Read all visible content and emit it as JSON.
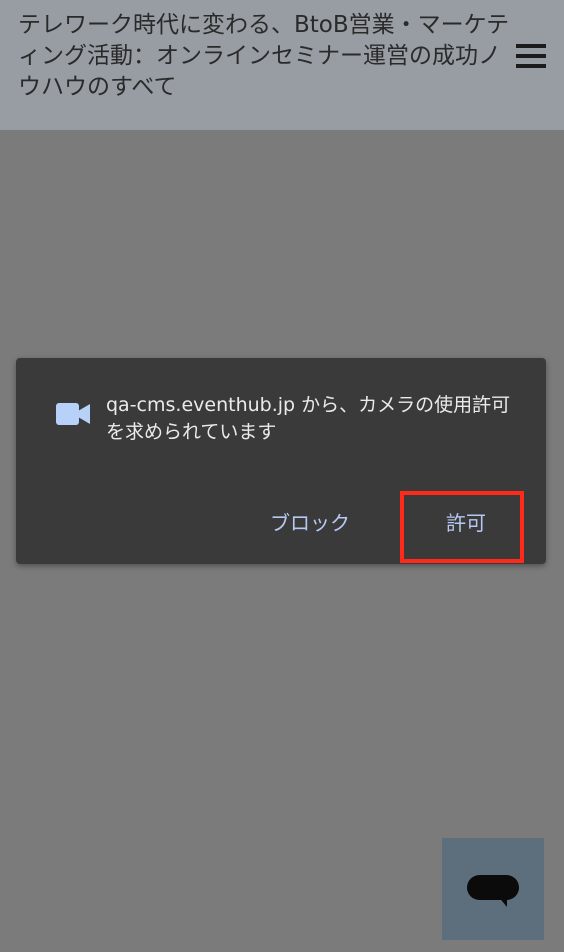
{
  "header": {
    "title": "テレワーク時代に変わる、BtoB営業・マーケティング活動：オンラインセミナー運営の成功ノウハウのすべて",
    "menu_icon": "hamburger-menu-icon"
  },
  "permission_dialog": {
    "icon": "video-camera-icon",
    "message": "qa-cms.eventhub.jp から、カメラの使用許可を求められています",
    "block_label": "ブロック",
    "allow_label": "許可"
  },
  "chat": {
    "icon": "chat-bubble-icon"
  },
  "colors": {
    "overlay_bg": "#7b7b7b",
    "header_bg": "#979da3",
    "dialog_bg": "#3a3a3a",
    "button_text": "#b7c9f3",
    "camera_icon": "#b7d1f8",
    "highlight": "#ff2a1a",
    "chat_button_bg": "#5d6f7c"
  }
}
